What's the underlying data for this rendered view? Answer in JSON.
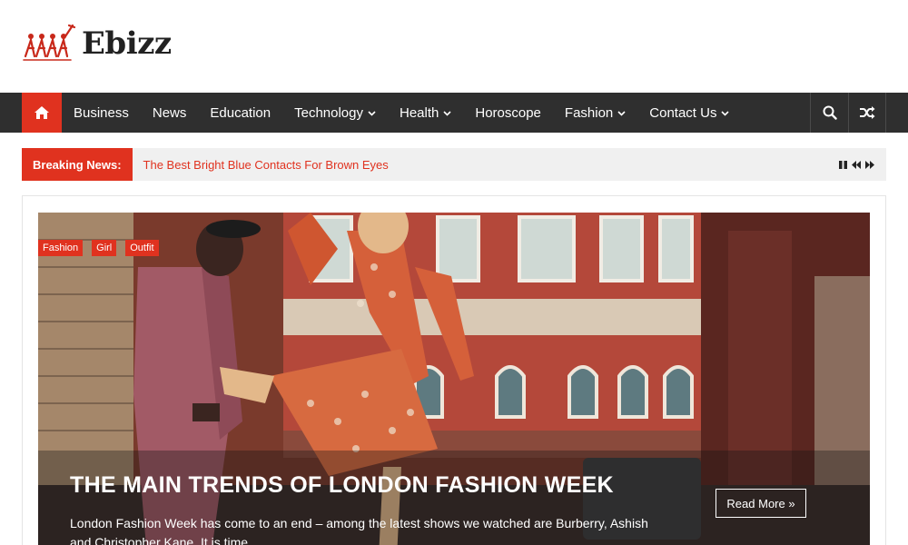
{
  "site": {
    "name": "Ebizz"
  },
  "nav": {
    "items": [
      {
        "label": "Business",
        "dropdown": false
      },
      {
        "label": "News",
        "dropdown": false
      },
      {
        "label": "Education",
        "dropdown": false
      },
      {
        "label": "Technology",
        "dropdown": true
      },
      {
        "label": "Health",
        "dropdown": true
      },
      {
        "label": "Horoscope",
        "dropdown": false
      },
      {
        "label": "Fashion",
        "dropdown": true
      },
      {
        "label": "Contact Us",
        "dropdown": true
      }
    ]
  },
  "breaking": {
    "label": "Breaking News:",
    "headline": "The Best Bright Blue Contacts For Brown Eyes"
  },
  "featured": {
    "tags": [
      "Fashion",
      "Girl",
      "Outfit"
    ],
    "title": "The Main Trends of London Fashion Week",
    "excerpt": "London Fashion Week has come to an end – among the latest shows we watched are Burberry, Ashish and Christopher Kane. It is time",
    "read_more": "Read More »"
  },
  "colors": {
    "accent": "#e0321f",
    "nav_bg": "#2f2f2f",
    "breaking_bg": "#f0f0f0"
  }
}
